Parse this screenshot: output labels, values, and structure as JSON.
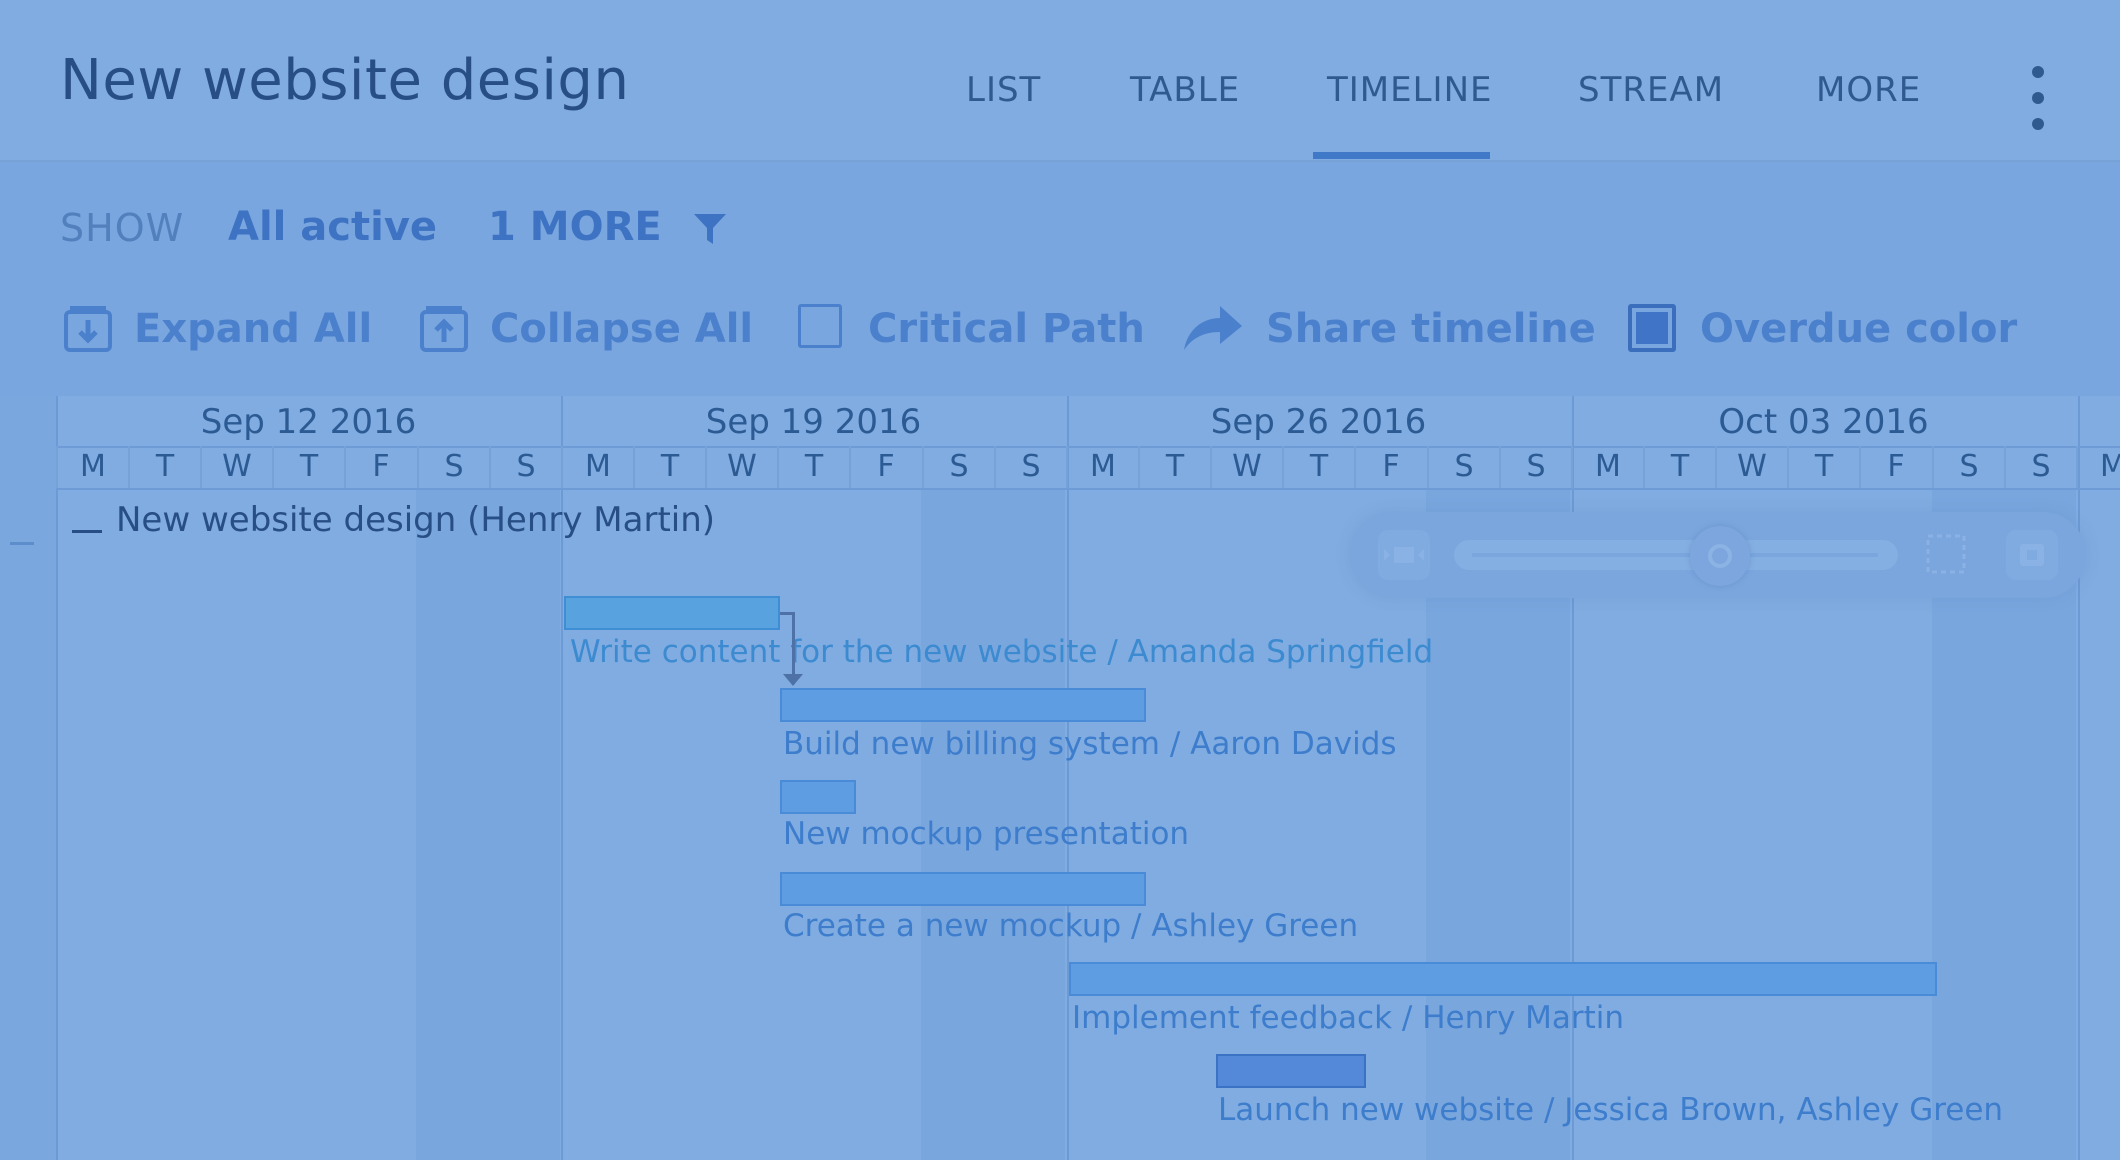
{
  "header": {
    "title": "New website design",
    "tabs": [
      {
        "label": "LIST"
      },
      {
        "label": "TABLE"
      },
      {
        "label": "TIMELINE",
        "active": true
      },
      {
        "label": "STREAM"
      },
      {
        "label": "MORE"
      }
    ]
  },
  "filter": {
    "show_label": "SHOW",
    "status_value": "All active",
    "more_value": "1 MORE"
  },
  "actions": {
    "expand_all": "Expand All",
    "collapse_all": "Collapse All",
    "critical_path": "Critical Path",
    "critical_path_checked": false,
    "share_timeline": "Share timeline",
    "overdue_color": "Overdue color",
    "overdue_color_checked": true
  },
  "timeline": {
    "weeks": [
      "Sep 12 2016",
      "Sep 19 2016",
      "Sep 26 2016",
      "Oct 03 2016"
    ],
    "days": [
      "M",
      "T",
      "W",
      "T",
      "F",
      "S",
      "S",
      "M",
      "T",
      "W",
      "T",
      "F",
      "S",
      "S",
      "M",
      "T",
      "W",
      "T",
      "F",
      "S",
      "S",
      "M",
      "T",
      "W",
      "T",
      "F",
      "S",
      "S",
      "M"
    ],
    "project": "New website design (Henry Martin)",
    "tasks": [
      {
        "label": "Write content for the new website / Amanda Springfield"
      },
      {
        "label": "Build new billing system / Aaron Davids"
      },
      {
        "label": "New mockup presentation"
      },
      {
        "label": "Create a new mockup / Ashley Green"
      },
      {
        "label": "Implement feedback / Henry Martin"
      },
      {
        "label": "Launch new website / Jessica Brown, Ashley Green"
      }
    ]
  },
  "colors": {
    "accent": "#3d73c2",
    "bar": "#5e9de2",
    "header_text": "#284f85"
  }
}
